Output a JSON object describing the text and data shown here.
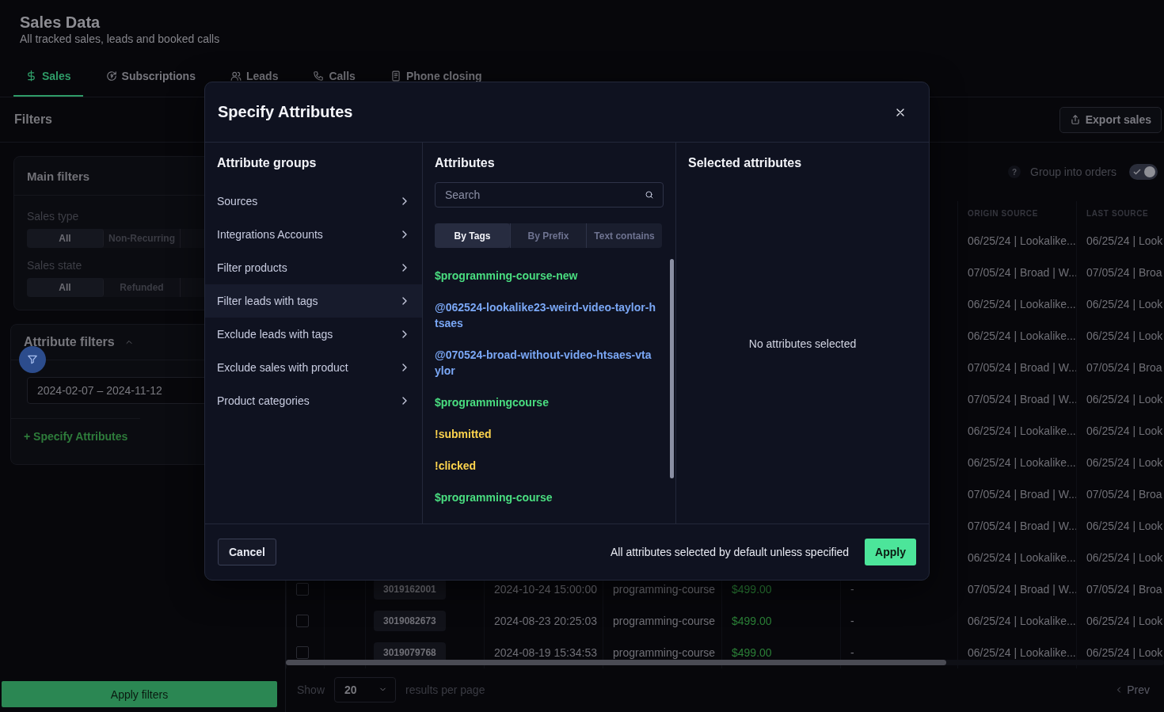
{
  "page": {
    "title": "Sales Data",
    "subtitle": "All tracked sales, leads and booked calls"
  },
  "tabs": [
    {
      "label": "Sales",
      "selected": true
    },
    {
      "label": "Subscriptions",
      "selected": false
    },
    {
      "label": "Leads",
      "selected": false
    },
    {
      "label": "Calls",
      "selected": false
    },
    {
      "label": "Phone closing",
      "selected": false
    }
  ],
  "filters": {
    "title": "Filters",
    "main": {
      "title": "Main filters",
      "groups": [
        {
          "label": "Sales type",
          "options": [
            {
              "label": "All",
              "selected": true
            },
            {
              "label": "Non-Recurring",
              "selected": false
            }
          ]
        },
        {
          "label": "Sales state",
          "options": [
            {
              "label": "All",
              "selected": true
            },
            {
              "label": "Refunded",
              "selected": false
            }
          ]
        }
      ]
    },
    "attribute": {
      "title": "Attribute filters",
      "expanded": true,
      "date_range": "2024-02-07 – 2024-11-12",
      "add_link": "+ Specify Attributes"
    },
    "apply_button": "Apply filters"
  },
  "toolbar": {
    "export_button": "Export sales",
    "help": "?",
    "group_label": "Group into orders",
    "group_on": true
  },
  "table": {
    "columns": [
      "ORIGIN SOURCE",
      "LAST SOURCE"
    ],
    "rows": [
      {
        "origin_source": "06/25/24 | Lookalike...",
        "last_source": "06/25/24 | Look"
      },
      {
        "origin_source": "07/05/24 | Broad | W...",
        "last_source": "07/05/24 | Broa"
      },
      {
        "origin_source": "06/25/24 | Lookalike...",
        "last_source": "06/25/24 | Look"
      },
      {
        "origin_source": "06/25/24 | Lookalike...",
        "last_source": "06/25/24 | Look"
      },
      {
        "origin_source": "07/05/24 | Broad | W...",
        "last_source": "07/05/24 | Broa"
      },
      {
        "origin_source": "07/05/24 | Broad | W...",
        "last_source": "06/25/24 | Look"
      },
      {
        "origin_source": "06/25/24 | Lookalike...",
        "last_source": "06/25/24 | Look"
      },
      {
        "origin_source": "06/25/24 | Lookalike...",
        "last_source": "06/25/24 | Look"
      },
      {
        "origin_source": "07/05/24 | Broad | W...",
        "last_source": "07/05/24 | Broa"
      },
      {
        "origin_source": "07/05/24 | Broad | W...",
        "last_source": "06/25/24 | Look"
      },
      {
        "origin_source": "06/25/24 | Lookalike...",
        "last_source": "06/25/24 | Look"
      },
      {
        "checked": false,
        "sale_id": "3019162001",
        "date": "2024-10-24 15:00:00",
        "product": "programming-course",
        "amount": "$499.00",
        "column_7": "-",
        "origin_source": "07/05/24 | Broad | W...",
        "last_source": "07/05/24 | Broa"
      },
      {
        "checked": false,
        "sale_id": "3019082673",
        "date": "2024-08-23 20:25:03",
        "product": "programming-course",
        "amount": "$499.00",
        "column_7": "-",
        "origin_source": "06/25/24 | Lookalike...",
        "last_source": "06/25/24 | Look"
      },
      {
        "checked": false,
        "sale_id": "3019079768",
        "date": "2024-08-19 15:34:53",
        "product": "programming-course",
        "amount": "$499.00",
        "column_7": "-",
        "origin_source": "06/25/24 | Lookalike...",
        "last_source": "06/25/24 | Look"
      }
    ]
  },
  "pagination": {
    "show_label": "Show",
    "page_size": "20",
    "per_page_label": "results per page",
    "prev": "Prev"
  },
  "modal": {
    "title": "Specify Attributes",
    "groups_heading": "Attribute groups",
    "groups": [
      {
        "label": "Sources",
        "selected": false
      },
      {
        "label": "Integrations Accounts",
        "selected": false
      },
      {
        "label": "Filter products",
        "selected": false
      },
      {
        "label": "Filter leads with tags",
        "selected": true
      },
      {
        "label": "Exclude leads with tags",
        "selected": false
      },
      {
        "label": "Exclude sales with product",
        "selected": false
      },
      {
        "label": "Product categories",
        "selected": false
      }
    ],
    "attributes_heading": "Attributes",
    "search_placeholder": "Search",
    "modes": [
      {
        "label": "By Tags",
        "selected": true
      },
      {
        "label": "By Prefix",
        "selected": false
      },
      {
        "label": "Text contains",
        "selected": false
      }
    ],
    "attributes": [
      {
        "label": "$programming-course-new",
        "color": "#4ade80"
      },
      {
        "label": "@062524-lookalike23-weird-video-taylor-htsaes",
        "color": "#7aa7f5"
      },
      {
        "label": "@070524-broad-without-video-htsaes-vtaylor",
        "color": "#7aa7f5"
      },
      {
        "label": "$programmingcourse",
        "color": "#4ade80"
      },
      {
        "label": "!submitted",
        "color": "#fcd34d"
      },
      {
        "label": "!clicked",
        "color": "#fcd34d"
      },
      {
        "label": "$programming-course",
        "color": "#4ade80"
      }
    ],
    "selected_heading": "Selected attributes",
    "empty_text": "No attributes selected",
    "cancel": "Cancel",
    "note": "All attributes selected by default unless specified",
    "apply": "Apply"
  }
}
